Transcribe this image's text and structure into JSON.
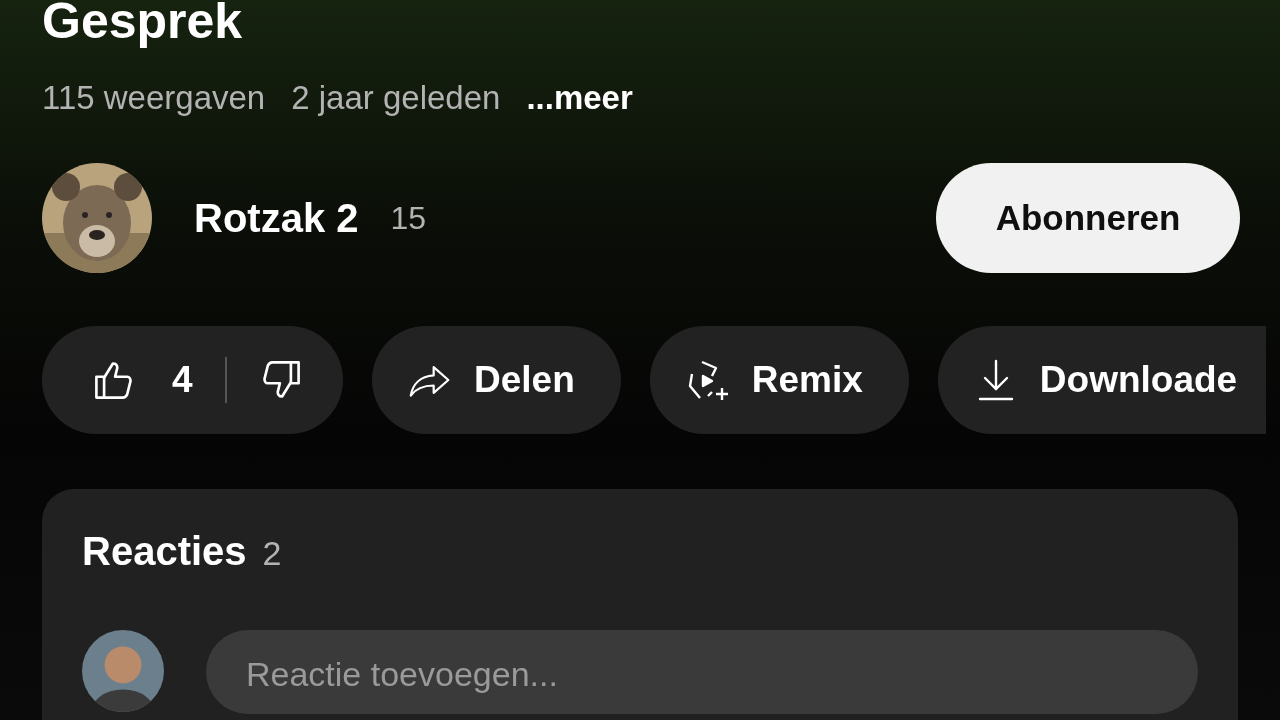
{
  "video": {
    "title": "Gesprek",
    "views": "115 weergaven",
    "age": "2 jaar geleden",
    "more": "...meer"
  },
  "channel": {
    "name": "Rotzak 2",
    "subscribers": "15",
    "subscribe": "Abonneren"
  },
  "actions": [
    {
      "kind": "like",
      "likes": "4"
    },
    {
      "kind": "share",
      "label": "Delen"
    },
    {
      "kind": "remix",
      "label": "Remix"
    },
    {
      "kind": "download",
      "label": "Downloade"
    }
  ],
  "comments": {
    "title": "Reacties",
    "count": "2",
    "placeholder": "Reactie toevoegen..."
  }
}
